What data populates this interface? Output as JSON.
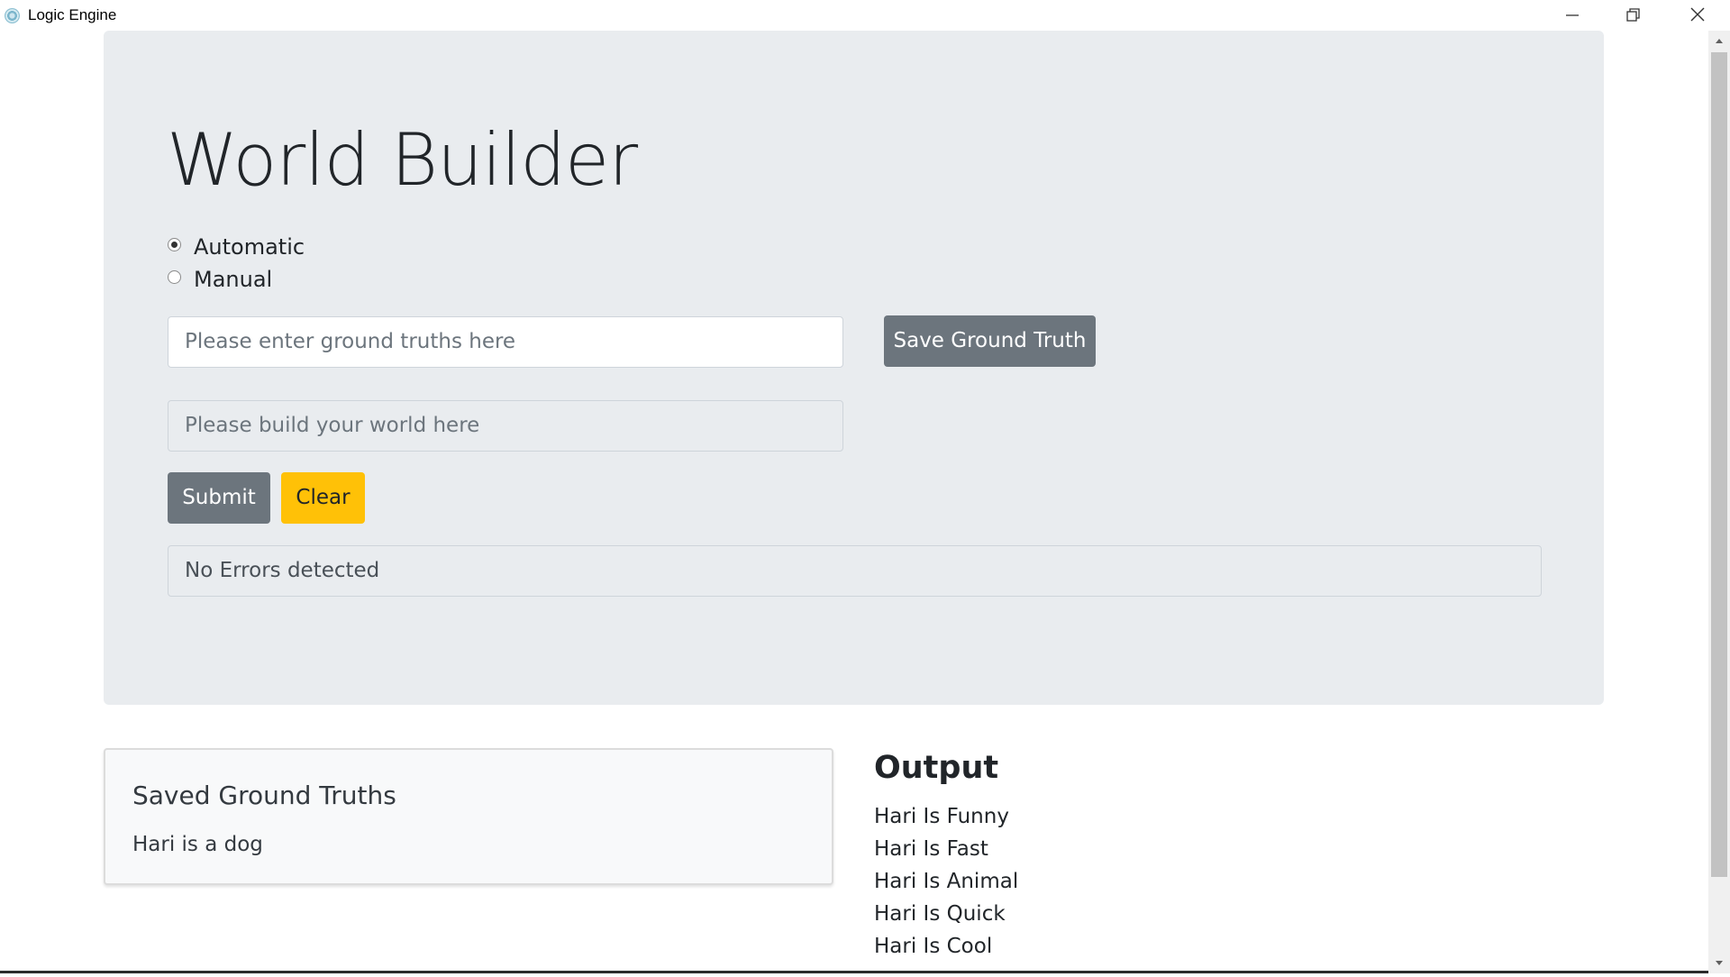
{
  "window": {
    "title": "Logic Engine",
    "icon": "electron-icon",
    "controls": [
      "minimize-icon",
      "restore-icon",
      "close-icon"
    ]
  },
  "main": {
    "title": "World Builder",
    "mode_options": [
      {
        "label": "Automatic",
        "checked": true
      },
      {
        "label": "Manual",
        "checked": false
      }
    ],
    "ground_truth_input": {
      "value": "",
      "placeholder": "Please enter ground truths here"
    },
    "save_button_label": "Save Ground Truth",
    "world_input": {
      "value": "",
      "placeholder": "Please build your world here"
    },
    "submit_label": "Submit",
    "clear_label": "Clear",
    "status_text": "No Errors detected"
  },
  "saved": {
    "title": "Saved Ground Truths",
    "items": [
      "Hari is a dog"
    ]
  },
  "output": {
    "title": "Output",
    "items": [
      "Hari Is Funny",
      "Hari Is Fast",
      "Hari Is Animal",
      "Hari Is Quick",
      "Hari Is Cool"
    ]
  },
  "colors": {
    "jumbotron_bg": "#e9ecef",
    "secondary_button": "#6c757d",
    "warning_button": "#ffc107"
  }
}
